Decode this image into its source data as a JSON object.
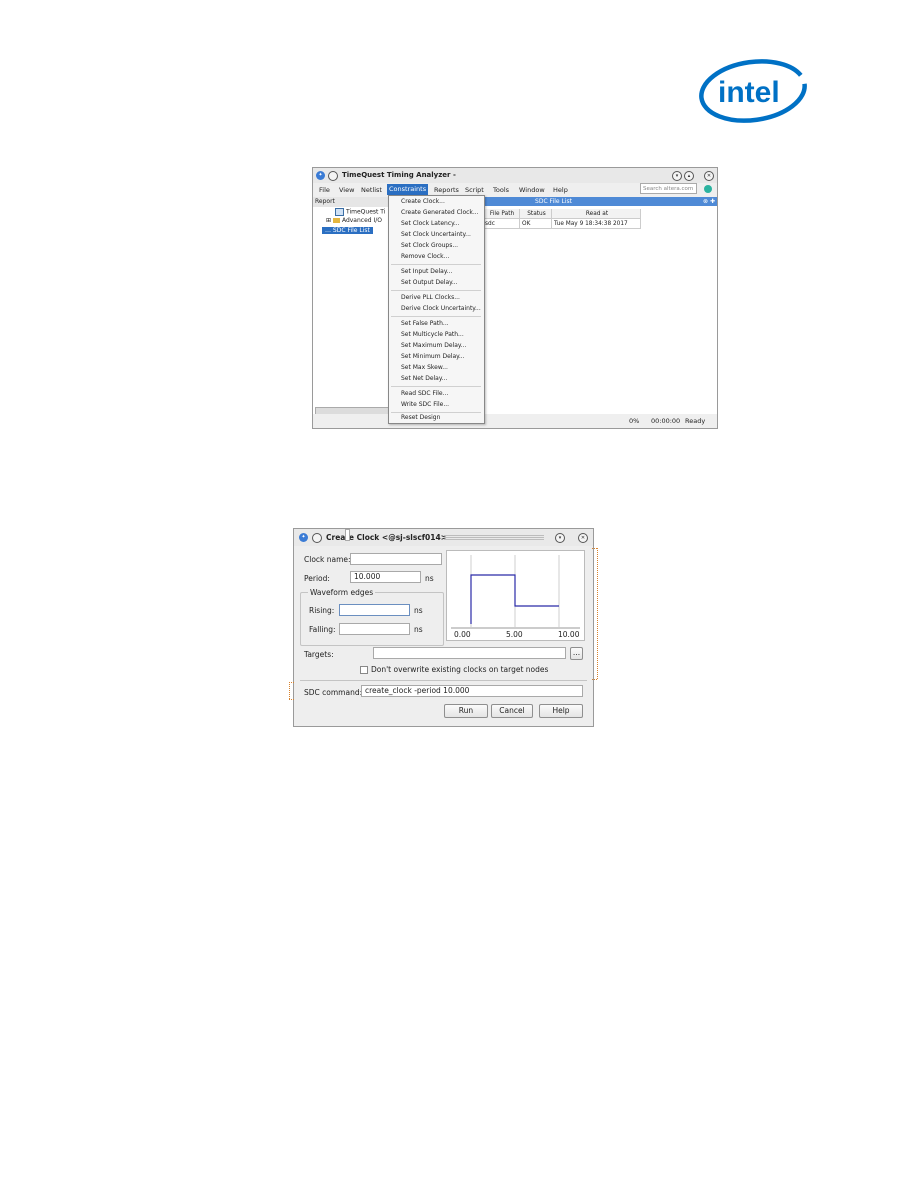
{
  "brand": {
    "logo_text": "intel",
    "logo_color": "#0071c5"
  },
  "timequest": {
    "title": "TimeQuest Timing Analyzer -",
    "menu": [
      "File",
      "View",
      "Netlist",
      "Constraints",
      "Reports",
      "Script",
      "Tools",
      "Window",
      "Help"
    ],
    "active_menu": "Constraints",
    "search_placeholder": "Search altera.com",
    "report_header": "Report",
    "tree": [
      "TimeQuest Ti",
      "Advanced I/O",
      "SDC File List"
    ],
    "sdc_panel_title": "SDC File List",
    "columns": [
      "File Path",
      "Status",
      "Read at"
    ],
    "row": {
      "path": "sdc",
      "status": "OK",
      "read_at": "Tue May  9 18:34:38 2017"
    },
    "dropdown": [
      [
        "Create Clock...",
        "Create Generated Clock...",
        "Set Clock Latency...",
        "Set Clock Uncertainty...",
        "Set Clock Groups...",
        "Remove Clock..."
      ],
      [
        "Set Input Delay...",
        "Set Output Delay..."
      ],
      [
        "Derive PLL Clocks...",
        "Derive Clock Uncertainty..."
      ],
      [
        "Set False Path...",
        "Set Multicycle Path...",
        "Set Maximum Delay...",
        "Set Minimum Delay...",
        "Set Max Skew...",
        "Set Net Delay..."
      ],
      [
        "Read SDC File...",
        "Write SDC File..."
      ],
      [
        "Reset Design"
      ]
    ],
    "status": {
      "progress": "0%",
      "time": "00:00:00",
      "state": "Ready"
    }
  },
  "create_clock": {
    "title": "Create Clock <@sj-slscf014>",
    "clock_name_label": "Clock name:",
    "clock_name_value": "",
    "period_label": "Period:",
    "period_value": "10.000",
    "period_unit": "ns",
    "waveform_group": "Waveform edges",
    "rising_label": "Rising:",
    "rising_unit": "ns",
    "falling_label": "Falling:",
    "falling_unit": "ns",
    "targets_label": "Targets:",
    "browse_label": "...",
    "dont_overwrite_label": "Don't overwrite existing clocks on target nodes",
    "sdc_command_label": "SDC command:",
    "sdc_command_value": "create_clock -period 10.000",
    "buttons": {
      "run": "Run",
      "cancel": "Cancel",
      "help": "Help"
    },
    "waveform": {
      "ticks": [
        "0.00",
        "5.00",
        "10.00"
      ],
      "rise_at": 0,
      "fall_at": 5,
      "period": 10,
      "line_color": "#2a2aa8"
    }
  }
}
